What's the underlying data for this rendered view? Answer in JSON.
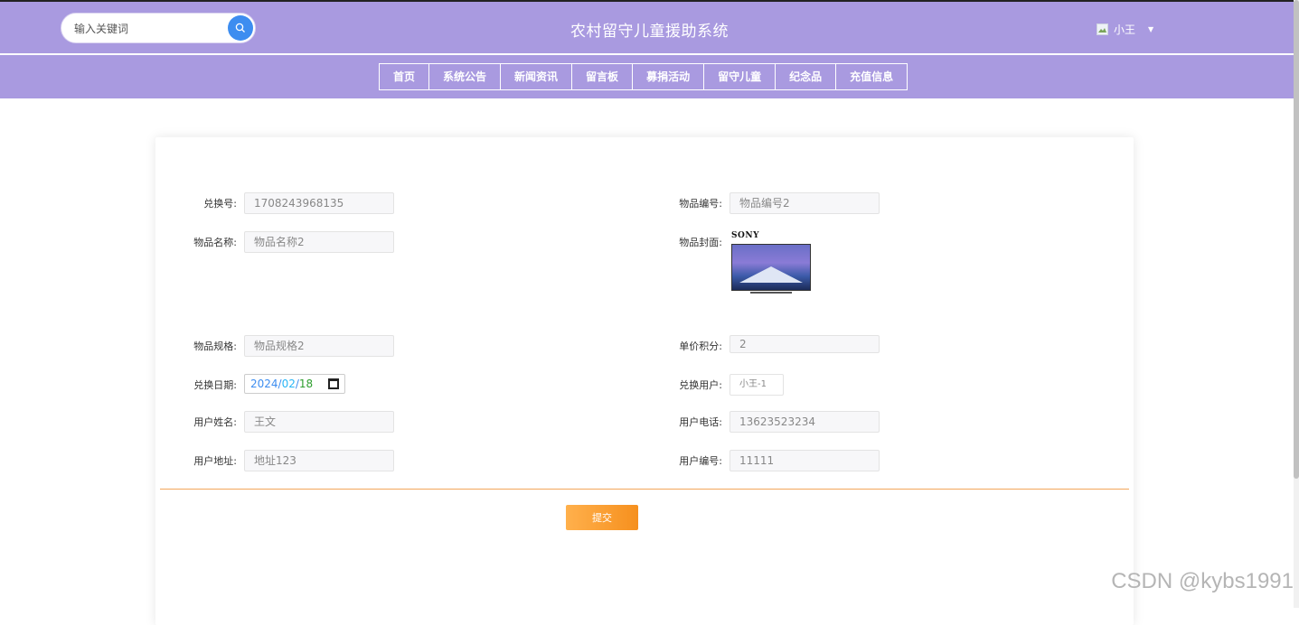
{
  "header": {
    "search_placeholder": "输入关键词",
    "site_title": "农村留守儿童援助系统",
    "user_name": "小王"
  },
  "nav": [
    "首页",
    "系统公告",
    "新闻资讯",
    "留言板",
    "募捐活动",
    "留守儿童",
    "纪念品",
    "充值信息"
  ],
  "form": {
    "exchange_no_label": "兑换号:",
    "exchange_no": "1708243968135",
    "item_code_label": "物品编号:",
    "item_code": "物品编号2",
    "item_name_label": "物品名称:",
    "item_name": "物品名称2",
    "item_cover_label": "物品封面:",
    "item_cover_brand": "SONY",
    "item_spec_label": "物品规格:",
    "item_spec": "物品规格2",
    "unit_points_label": "单价积分:",
    "unit_points": "2",
    "exchange_date_label": "兑换日期:",
    "exchange_date": {
      "year": "2024",
      "month": "02",
      "day": "18"
    },
    "exchange_user_label": "兑换用户:",
    "exchange_user": "小王-1",
    "user_realname_label": "用户姓名:",
    "user_realname": "王文",
    "user_phone_label": "用户电话:",
    "user_phone": "13623523234",
    "user_address_label": "用户地址:",
    "user_address": "地址123",
    "user_no_label": "用户编号:",
    "user_no": "11111",
    "submit_label": "提交"
  },
  "watermark": "CSDN @kybs1991",
  "colors": {
    "header_bg": "#a99ae0",
    "search_btn": "#3d8df0",
    "submit_btn": "#f6901e",
    "divider": "#f3a65a"
  }
}
